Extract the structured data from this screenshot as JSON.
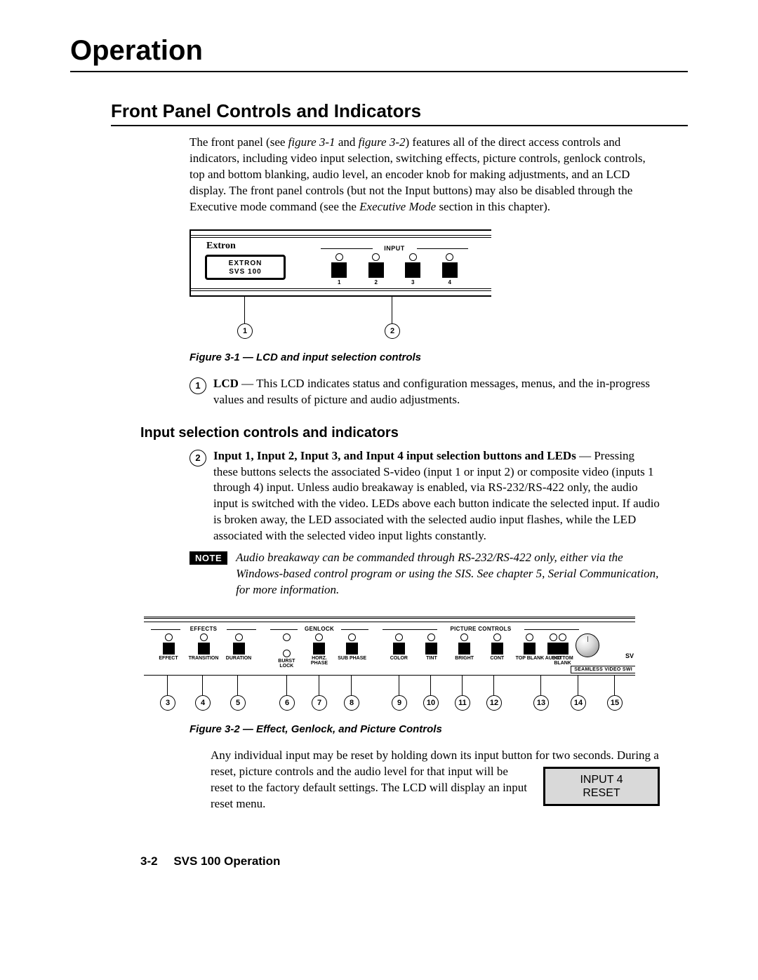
{
  "chapter_title": "Operation",
  "section_title": "Front Panel Controls and Indicators",
  "intro": {
    "pre": "The front panel (see ",
    "ref1": "figure 3‑1",
    "mid1": " and ",
    "ref2": "figure 3‑2",
    "post": ") features all of the direct access controls and indicators, including video input selection, switching effects, picture controls, genlock controls, top and bottom blanking, audio level, an encoder knob for making adjustments, and an LCD display.  The front panel controls (but not the Input buttons) may also be disabled through the Executive mode command (see the ",
    "ref3": "Executive Mode",
    "post2": " section in this chapter)."
  },
  "fig31": {
    "brand": "Extron",
    "lcd_line1": "EXTRON",
    "lcd_line2": "SVS    100",
    "input_label": "INPUT",
    "buttons": [
      "1",
      "2",
      "3",
      "4"
    ],
    "callouts": [
      "1",
      "2"
    ],
    "caption": "Figure 3-1 — LCD and input selection controls"
  },
  "callout1": {
    "num": "1",
    "lead": "LCD",
    "text": " — This LCD indicates status and configuration messages, menus, and the in-progress values and results of picture and audio adjustments."
  },
  "subsection_title": "Input selection controls and indicators",
  "callout2": {
    "num": "2",
    "lead": "Input 1, Input 2, Input 3, and Input 4 input selection buttons and LEDs",
    "text": " — Pressing these buttons selects the associated S-video (input 1 or input 2) or composite video (inputs 1 through 4) input.  Unless audio breakaway is enabled, via RS-232/RS-422 only, the audio input is switched with the video.  LEDs above each button indicate the selected input.  If audio is broken away, the LED associated with the selected audio input flashes, while the LED associated with the selected video input lights constantly."
  },
  "note": {
    "badge": "NOTE",
    "text": "Audio breakaway can be commanded through RS-232/RS-422 only, either via the Windows-based control program or using the SIS. See chapter 5, Serial Communication, for more information."
  },
  "fig32": {
    "groups": {
      "effects": {
        "label": "EFFECTS",
        "items": [
          "EFFECT",
          "TRANSITION",
          "DURATION"
        ]
      },
      "genlock": {
        "label": "GENLOCK",
        "items": [
          "BURST\nLOCK",
          "HORZ.\nPHASE",
          "SUB\nPHASE"
        ]
      },
      "picture": {
        "label": "PICTURE CONTROLS",
        "items": [
          "COLOR",
          "TINT",
          "BRIGHT",
          "CONT",
          "TOP\nBLANK",
          "BOTTOM\nBLANK"
        ]
      },
      "audio_label": "AUDIO",
      "sv": "SV",
      "seamless": "SEAMLESS VIDEO SWI"
    },
    "callouts": [
      "3",
      "4",
      "5",
      "6",
      "7",
      "8",
      "9",
      "10",
      "11",
      "12",
      "13",
      "14",
      "15"
    ],
    "caption": "Figure 3-2 — Effect, Genlock, and Picture Controls"
  },
  "reset_para_first": "Any individual input may be reset by holding down its input button for two seconds.  During a reset, picture controls and",
  "reset_para_rest": "the audio level for that input will be reset to the factory default settings.  The LCD will display an input reset menu.",
  "reset_lcd": {
    "line1": "INPUT 4",
    "line2": "RESET"
  },
  "footer": {
    "page": "3-2",
    "doc": "SVS 100 Operation"
  }
}
